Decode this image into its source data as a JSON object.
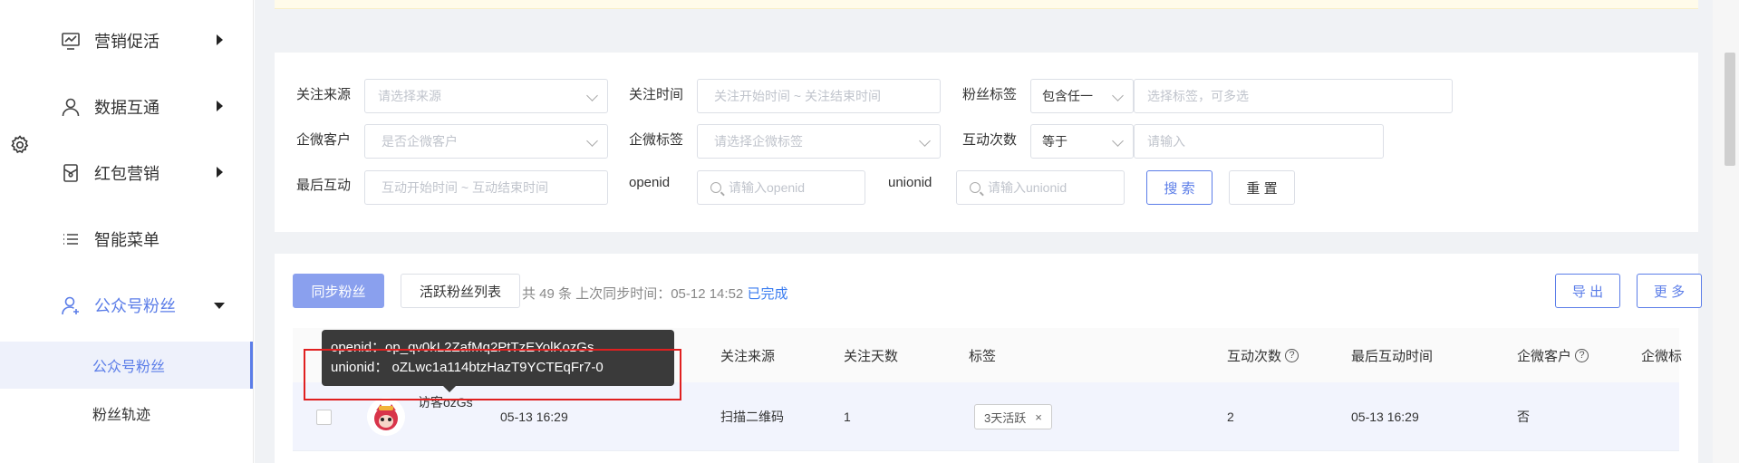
{
  "sidebar": {
    "items": [
      {
        "label": "营销促活",
        "icon": "chart-board-icon"
      },
      {
        "label": "数据互通",
        "icon": "user-icon"
      },
      {
        "label": "红包营销",
        "icon": "red-packet-icon"
      },
      {
        "label": "智能菜单",
        "icon": "menu-list-icon"
      },
      {
        "label": "公众号粉丝",
        "icon": "user-plus-icon"
      }
    ],
    "sub_items": [
      {
        "label": "公众号粉丝"
      },
      {
        "label": "粉丝轨迹"
      }
    ],
    "accent": "#5b7de8"
  },
  "filters": {
    "follow_source": {
      "label": "关注来源",
      "placeholder": "请选择来源"
    },
    "follow_time": {
      "label": "关注时间",
      "placeholder": "关注开始时间 ~ 关注结束时间"
    },
    "fan_tags": {
      "label": "粉丝标签",
      "mode": "包含任一",
      "placeholder": "选择标签，可多选"
    },
    "wecom_customer": {
      "label": "企微客户",
      "placeholder": "是否企微客户"
    },
    "wecom_tags": {
      "label": "企微标签",
      "placeholder": "请选择企微标签"
    },
    "interact_count": {
      "label": "互动次数",
      "op": "等于",
      "placeholder": "请输入"
    },
    "last_interact": {
      "label": "最后互动",
      "placeholder": "互动开始时间 ~ 互动结束时间"
    },
    "openid": {
      "label": "openid",
      "placeholder": "请输入openid"
    },
    "unionid": {
      "label": "unionid",
      "placeholder": "请输入unionid"
    },
    "search_label": "搜 索",
    "reset_label": "重 置"
  },
  "toolbar": {
    "sync_label": "同步粉丝",
    "active_list_label": "活跃粉丝列表",
    "sync_info": "共 49 条 上次同步时间：05-12 14:52",
    "sync_status": "已完成",
    "export_label": "导 出",
    "more_label": "更 多"
  },
  "table": {
    "columns": [
      "关注来源",
      "关注天数",
      "标签",
      "互动次数",
      "最后互动时间",
      "企微客户",
      "企微标"
    ],
    "help_icon": "?",
    "rows": [
      {
        "nickname": "访客ozGs",
        "follow_time": "05-13 16:29",
        "source": "扫描二维码",
        "days": "1",
        "tag": "3天活跃",
        "tag_close": "×",
        "interactions": "2",
        "last_interact": "05-13 16:29",
        "wecom": "否"
      }
    ]
  },
  "tooltip": {
    "openid_line": "openid：op_qv0kL2ZafMq2PtTzEYolKozGs",
    "unionid_line": "unionid： oZLwc1a114btzHazT9YCTEqFr7-0"
  }
}
